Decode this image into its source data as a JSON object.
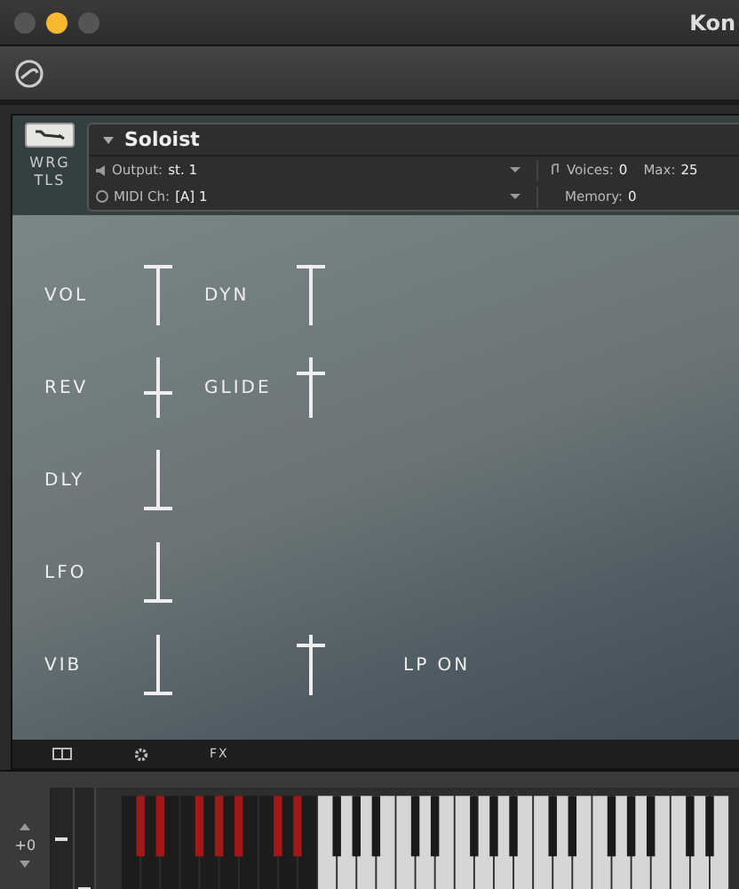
{
  "window": {
    "title": "Kon"
  },
  "instrument": {
    "name": "Soloist",
    "tools_label": "WRG\nTLS",
    "output_label": "Output:",
    "output": "st. 1",
    "voices_label": "Voices:",
    "voices": "0",
    "max_label": "Max:",
    "max": "25",
    "midi_label": "MIDI Ch:",
    "midi": "[A] 1",
    "memory_label": "Memory:",
    "memory": "0"
  },
  "controls": [
    [
      {
        "kind": "slider",
        "label": "VOL",
        "level": 1
      },
      {
        "kind": "slider",
        "label": "DYN",
        "level": 1
      }
    ],
    [
      {
        "kind": "slider",
        "label": "REV",
        "level": 0.4
      },
      {
        "kind": "slider",
        "label": "GLIDE",
        "level": 0.75
      }
    ],
    [
      {
        "kind": "slider",
        "label": "DLY",
        "level": 0
      }
    ],
    [
      {
        "kind": "slider",
        "label": "LFO",
        "level": 0
      }
    ],
    [
      {
        "kind": "slider",
        "label": "VIB",
        "level": 0
      },
      {
        "kind": "slider",
        "level": 0.85
      },
      {
        "kind": "text",
        "label": "LP ON"
      }
    ]
  ],
  "footer": {
    "fx_label": "FX"
  },
  "keyboard": {
    "transpose": "+0"
  }
}
